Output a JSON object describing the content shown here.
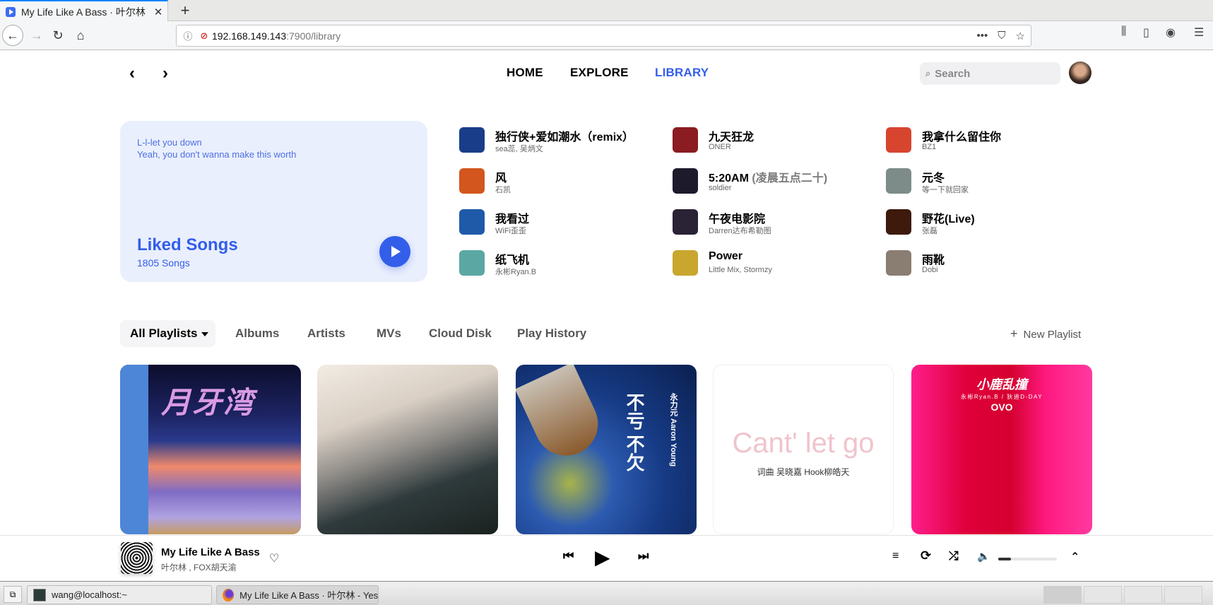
{
  "browser": {
    "tab_title": "My Life Like A Bass · 叶尔林",
    "tab_close": "✕",
    "new_tab": "+",
    "url_host": "192.168.149.143",
    "url_path": ":7900/library",
    "icons": {
      "back": "←",
      "forward": "→",
      "reload": "↻",
      "home": "⌂",
      "info": "ⓘ",
      "lock": "🔒",
      "more": "•••",
      "pocket": "⛉",
      "star": "☆",
      "library": "⫼",
      "sidebar": "▯",
      "account": "◉",
      "menu": "☰"
    }
  },
  "nav": {
    "back": "‹",
    "forward": "›",
    "links": [
      {
        "label": "HOME",
        "active": false
      },
      {
        "label": "EXPLORE",
        "active": false
      },
      {
        "label": "LIBRARY",
        "active": true
      }
    ],
    "search_placeholder": "Search",
    "search_icon": "⌕"
  },
  "liked": {
    "lyrics": [
      "L-l-let you down",
      "Yeah, you don't wanna make this worth"
    ],
    "title": "Liked Songs",
    "count": "1805 Songs"
  },
  "songs": [
    {
      "name": "独行侠+爱如潮水（remix）",
      "sub": "",
      "artist": "sea蕊, 吴炳文",
      "color": "#1a3d8a"
    },
    {
      "name": "九天狂龙",
      "sub": "",
      "artist": "ONER",
      "color": "#8a1c22"
    },
    {
      "name": "我拿什么留住你",
      "sub": "",
      "artist": "BZ1",
      "color": "#d8452f"
    },
    {
      "name": "风",
      "sub": "",
      "artist": "石凯",
      "color": "#d2561e"
    },
    {
      "name": "5:20AM",
      "sub": "(凌晨五点二十)",
      "artist": "soldier",
      "color": "#1d1a2c"
    },
    {
      "name": "元冬",
      "sub": "",
      "artist": "等一下就回家",
      "color": "#7d8c88"
    },
    {
      "name": "我看过",
      "sub": "",
      "artist": "WiFi歪歪",
      "color": "#1f5aa8"
    },
    {
      "name": "午夜电影院",
      "sub": "",
      "artist": "Darren达布希勒图",
      "color": "#2a2235"
    },
    {
      "name": "野花(Live)",
      "sub": "",
      "artist": "张磊",
      "color": "#3d1a0c"
    },
    {
      "name": "纸飞机",
      "sub": "",
      "artist": "永彬Ryan.B",
      "color": "#5aa7a3"
    },
    {
      "name": "Power",
      "sub": "",
      "artist": "Little Mix, Stormzy",
      "color": "#c9a62e"
    },
    {
      "name": "雨靴",
      "sub": "",
      "artist": "Dobi",
      "color": "#8a7d72"
    }
  ],
  "library_tabs": {
    "all": "All Playlists",
    "items": [
      "Albums",
      "Artists",
      "MVs",
      "Cloud Disk",
      "Play History"
    ],
    "new_playlist": "New Playlist",
    "new_icon": "+"
  },
  "playlists": [
    {
      "cover_text": "月牙湾"
    },
    {
      "cover_text": ""
    },
    {
      "cover_text": "不亏 不欠",
      "cover_sub": "永力元 Aaron Young"
    },
    {
      "cover_text": "Cant' let go",
      "cover_sub": "词曲 吴晓嘉    Hook柳皓天"
    },
    {
      "cover_text": "小鹿乱撞",
      "cover_sub": "永彬Ryan.B / 狄迪D-DAY",
      "cover_logo": "OVO"
    }
  ],
  "player": {
    "title": "My Life Like A Bass",
    "artist": "叶尔林 , FOX胡天渝",
    "heart": "♡",
    "prev": "⏮",
    "play": "▶",
    "next": "⏭",
    "queue": "≡",
    "repeat": "⟳",
    "shuffle": "⤮",
    "volume": "🔈",
    "volume_level": 0.22,
    "expand": "⌃"
  },
  "taskbar": {
    "show_desktop": "⧉",
    "terminal": "wang@localhost:~",
    "firefox": "My Life Like A Bass · 叶尔林 - YesPl..."
  }
}
